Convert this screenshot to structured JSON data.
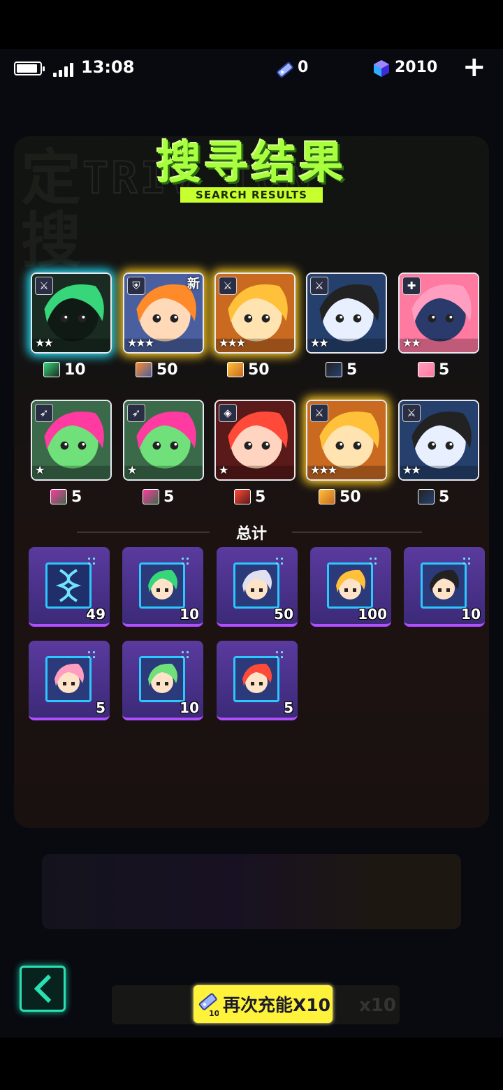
{
  "status_bar": {
    "time": "13:08",
    "battery_level": 0.9,
    "energy": "0",
    "gems": "2010",
    "add_label": "+"
  },
  "title": "搜寻结果",
  "subtitle": "SEARCH RESULTS",
  "results": [
    {
      "badge": "sword",
      "stars": "★★",
      "reward": "10",
      "glow": "cyan",
      "new": ""
    },
    {
      "badge": "shield",
      "stars": "★★★",
      "reward": "50",
      "glow": "gold",
      "new": "新"
    },
    {
      "badge": "sword",
      "stars": "★★★",
      "reward": "50",
      "glow": "gold",
      "new": ""
    },
    {
      "badge": "sword",
      "stars": "★★",
      "reward": "5",
      "glow": "",
      "new": ""
    },
    {
      "badge": "heal",
      "stars": "★★",
      "reward": "5",
      "glow": "",
      "new": ""
    },
    {
      "badge": "bow",
      "stars": "★",
      "reward": "5",
      "glow": "",
      "new": ""
    },
    {
      "badge": "bow",
      "stars": "★",
      "reward": "5",
      "glow": "",
      "new": ""
    },
    {
      "badge": "support",
      "stars": "★",
      "reward": "5",
      "glow": "",
      "new": ""
    },
    {
      "badge": "sword",
      "stars": "★★★",
      "reward": "50",
      "glow": "gold",
      "new": ""
    },
    {
      "badge": "sword",
      "stars": "★★",
      "reward": "5",
      "glow": "",
      "new": ""
    }
  ],
  "total_label": "总计",
  "totals": [
    {
      "icon": "dna-icon",
      "count": "49"
    },
    {
      "icon": "green-hair-shard-icon",
      "count": "10"
    },
    {
      "icon": "white-hood-shard-icon",
      "count": "50"
    },
    {
      "icon": "blonde-shard-icon",
      "count": "100"
    },
    {
      "icon": "black-hat-shard-icon",
      "count": "10"
    },
    {
      "icon": "pink-hair-shard-icon",
      "count": "5"
    },
    {
      "icon": "green-skin-shard-icon",
      "count": "10"
    },
    {
      "icon": "red-hair-shard-icon",
      "count": "5"
    }
  ],
  "again_button": {
    "label": "再次充能X10"
  },
  "colors": {
    "accent": "#a8ff3e",
    "button": "#fff23a",
    "back": "#29e0b4",
    "item": "#5a3a9e"
  }
}
